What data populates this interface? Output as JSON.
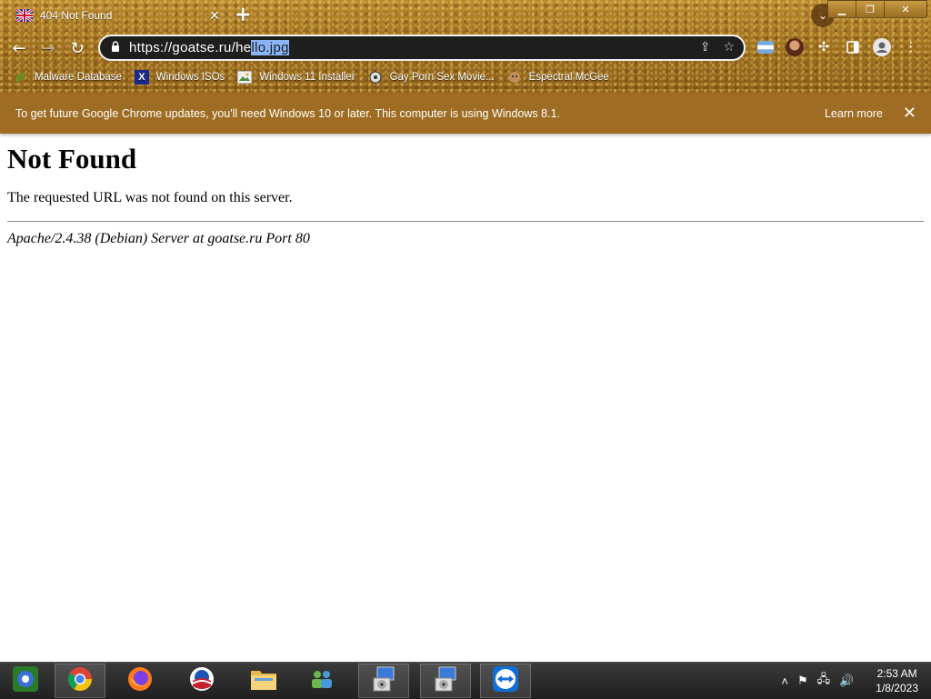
{
  "tab": {
    "title": "404 Not Found",
    "favicon": "uk-flag-icon"
  },
  "toolbar": {
    "url_prefix": "https://goatse.ru/h",
    "url_mid": "e",
    "url_selected": "llo.jpg"
  },
  "bookmarks": [
    {
      "label": "Malware Database",
      "icon": "leaf-icon"
    },
    {
      "label": "Windows ISOs",
      "icon": "x-logo-icon"
    },
    {
      "label": "Windows 11 Installer",
      "icon": "image-icon"
    },
    {
      "label": "Gay Porn Sex Movie...",
      "icon": "disc-icon"
    },
    {
      "label": "Espectral McGee",
      "icon": "face-icon"
    }
  ],
  "infobar": {
    "message": "To get future Google Chrome updates, you'll need Windows 10 or later. This computer is using Windows 8.1.",
    "link": "Learn more"
  },
  "page": {
    "heading": "Not Found",
    "message": "The requested URL was not found on this server.",
    "address": "Apache/2.4.38 (Debian) Server at goatse.ru Port 80"
  },
  "taskbar": {
    "time": "2:53 AM",
    "date": "1/8/2023"
  },
  "colors": {
    "infobar_bg": "#9f6c23",
    "frame": "#a3741f",
    "taskbar": "#262626"
  }
}
